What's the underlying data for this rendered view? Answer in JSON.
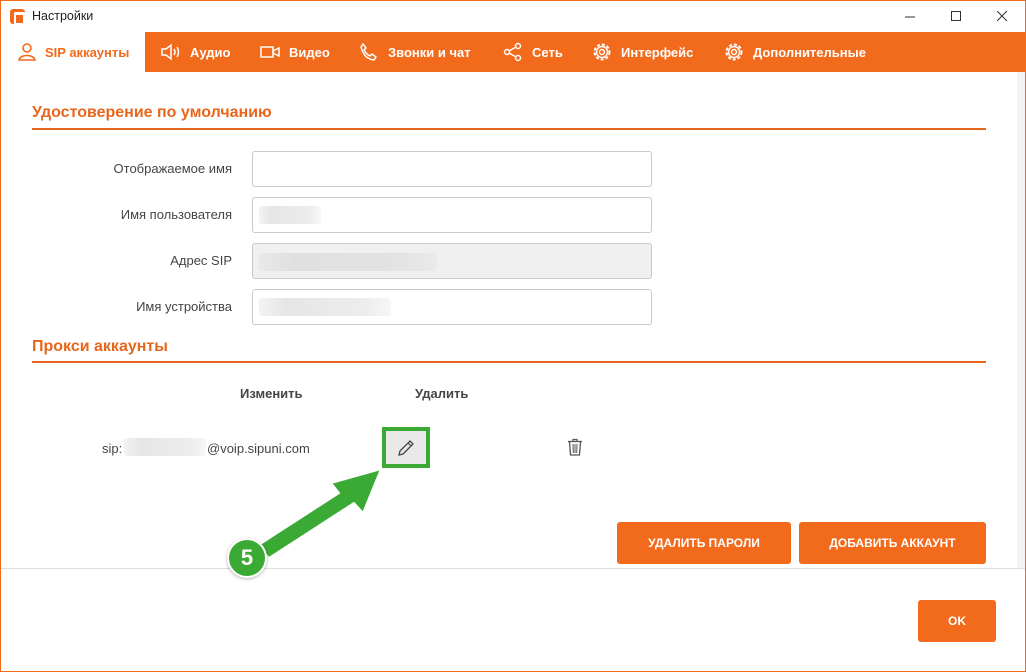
{
  "window": {
    "title": "Настройки",
    "minimize_icon": "minimize-icon",
    "maximize_icon": "maximize-icon",
    "close_icon": "close-icon"
  },
  "tabs": [
    {
      "label": "SIP аккаунты",
      "icon": "user-icon",
      "active": true
    },
    {
      "label": "Аудио",
      "icon": "speaker-icon",
      "active": false
    },
    {
      "label": "Видео",
      "icon": "video-camera-icon",
      "active": false
    },
    {
      "label": "Звонки и чат",
      "icon": "phone-icon",
      "active": false
    },
    {
      "label": "Сеть",
      "icon": "share-network-icon",
      "active": false
    },
    {
      "label": "Интерфейс",
      "icon": "gear-icon",
      "active": false
    },
    {
      "label": "Дополнительные",
      "icon": "gear-icon",
      "active": false
    }
  ],
  "identity": {
    "title": "Удостоверение по умолчанию",
    "display_name_label": "Отображаемое имя",
    "display_name_value": "",
    "username_label": "Имя пользователя",
    "sip_address_label": "Адрес SIP",
    "device_name_label": "Имя устройства"
  },
  "proxy": {
    "title": "Прокси аккаунты",
    "col_edit": "Изменить",
    "col_delete": "Удалить",
    "account_prefix": "sip:",
    "account_suffix": "@voip.sipuni.com"
  },
  "buttons": {
    "delete_passwords": "УДАЛИТЬ ПАРОЛИ",
    "add_account": "ДОБАВИТЬ АККАУНТ",
    "ok": "OK"
  },
  "annotation": {
    "step_number": "5",
    "color": "#3aaa35"
  },
  "colors": {
    "accent": "#f26a1b",
    "heading": "#e8661c"
  }
}
